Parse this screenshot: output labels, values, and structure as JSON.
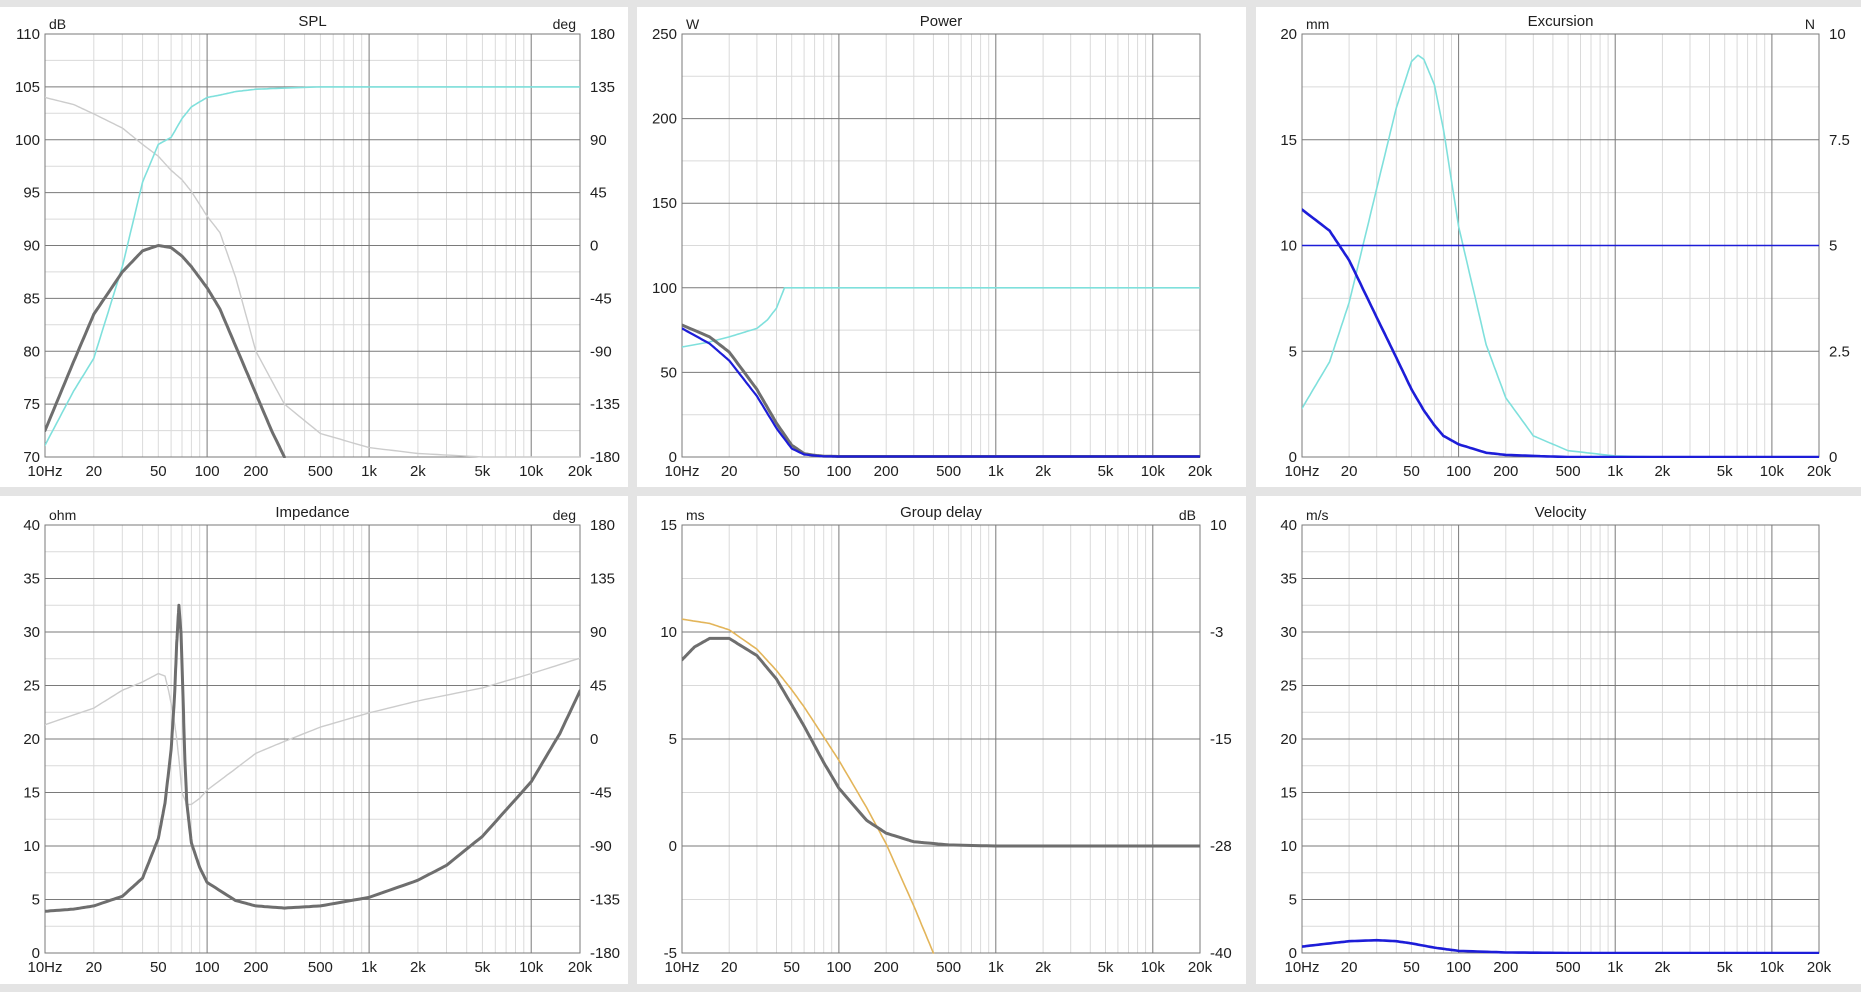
{
  "x_ticks": [
    "10Hz",
    "20",
    "50",
    "100",
    "200",
    "500",
    "1k",
    "2k",
    "5k",
    "10k",
    "20k"
  ],
  "chart_data": [
    {
      "type": "line",
      "title": "SPL",
      "y_unit": "dB",
      "y2_unit": "deg",
      "xscale": "log",
      "xlim": [
        10,
        20000
      ],
      "ylim": [
        70,
        110
      ],
      "y2lim": [
        -180,
        180
      ],
      "y_ticks": [
        "70",
        "75",
        "80",
        "85",
        "90",
        "95",
        "100",
        "105",
        "110"
      ],
      "y2_ticks": [
        "-180",
        "-135",
        "-90",
        "-45",
        "0",
        "45",
        "90",
        "135",
        "180"
      ],
      "series": [
        {
          "axis": "y2",
          "color": "#cccccc",
          "width": 1.4,
          "x": [
            10,
            15,
            20,
            30,
            40,
            50,
            60,
            70,
            80,
            100,
            120,
            150,
            200,
            300,
            500,
            1000,
            2000,
            5000,
            20000
          ],
          "y": [
            126,
            120,
            112,
            100,
            86,
            76,
            64,
            56,
            46,
            25,
            11,
            -27,
            -90,
            -135,
            -160,
            -172,
            -177,
            -180,
            -180
          ]
        },
        {
          "axis": "y2",
          "color": "#7fe0dc",
          "width": 1.6,
          "x": [
            10,
            15,
            20,
            30,
            40,
            50,
            60,
            70,
            80,
            100,
            120,
            150,
            200,
            300,
            500,
            1000,
            2000,
            5000,
            20000
          ],
          "y": [
            -170,
            -124,
            -96,
            -18,
            54,
            86,
            92,
            108,
            118,
            126,
            128,
            131,
            133,
            134,
            135,
            135,
            135,
            135,
            135
          ]
        },
        {
          "axis": "y",
          "color": "#6e6e6e",
          "width": 3,
          "x": [
            10,
            15,
            20,
            30,
            40,
            50,
            60,
            70,
            80,
            100,
            120,
            150,
            200,
            250,
            300
          ],
          "y": [
            72.5,
            79,
            83.5,
            87.5,
            89.5,
            90,
            89.8,
            89,
            88,
            86,
            84,
            80.5,
            76,
            72.5,
            70
          ]
        }
      ]
    },
    {
      "type": "line",
      "title": "Power",
      "y_unit": "W",
      "xscale": "log",
      "xlim": [
        10,
        20000
      ],
      "ylim": [
        0,
        250
      ],
      "y_ticks": [
        "0",
        "50",
        "100",
        "150",
        "200",
        "250"
      ],
      "series": [
        {
          "axis": "y",
          "color": "#7fe0dc",
          "width": 1.6,
          "x": [
            10,
            15,
            20,
            30,
            35,
            40,
            45,
            20000
          ],
          "y": [
            65,
            68,
            71,
            76,
            81,
            88,
            100,
            100
          ]
        },
        {
          "axis": "y",
          "color": "#6e6e6e",
          "width": 3,
          "x": [
            10,
            15,
            20,
            30,
            40,
            50,
            60,
            70,
            80,
            100,
            20000
          ],
          "y": [
            78,
            71,
            62,
            40,
            20,
            7,
            2,
            1,
            0.5,
            0.3,
            0.3
          ]
        },
        {
          "axis": "y",
          "color": "#1d1dd8",
          "width": 2.2,
          "x": [
            10,
            15,
            20,
            30,
            40,
            50,
            60,
            70,
            80,
            100,
            20000
          ],
          "y": [
            76,
            67,
            57,
            36,
            17,
            5,
            1.5,
            0.8,
            0.4,
            0.3,
            0.3
          ]
        }
      ]
    },
    {
      "type": "line",
      "title": "Excursion",
      "y_unit": "mm",
      "y2_unit": "N",
      "xscale": "log",
      "xlim": [
        10,
        20000
      ],
      "ylim": [
        0,
        20
      ],
      "y2lim": [
        0,
        10
      ],
      "y_ticks": [
        "0",
        "5",
        "10",
        "15",
        "20"
      ],
      "y2_ticks": [
        "0",
        "2.5",
        "5",
        "7.5",
        "10"
      ],
      "series": [
        {
          "axis": "y",
          "color": "#7fe0dc",
          "width": 1.6,
          "x": [
            10,
            15,
            20,
            30,
            40,
            50,
            55,
            60,
            70,
            80,
            100,
            150,
            200,
            300,
            500,
            1000,
            2000,
            5000,
            20000
          ],
          "y": [
            2.3,
            4.5,
            7.3,
            12.7,
            16.5,
            18.7,
            19,
            18.8,
            17.6,
            15.5,
            10.9,
            5.3,
            2.8,
            1,
            0.3,
            0.05,
            0,
            0,
            0
          ]
        },
        {
          "axis": "y2",
          "color": "#1d1dd8",
          "width": 1.4,
          "x": [
            10,
            20000
          ],
          "y": [
            5,
            5
          ]
        },
        {
          "axis": "y",
          "color": "#1d1dd8",
          "width": 2.6,
          "x": [
            10,
            15,
            20,
            30,
            40,
            50,
            60,
            70,
            80,
            100,
            150,
            200,
            300,
            500,
            1000,
            20000
          ],
          "y": [
            11.7,
            10.7,
            9.3,
            6.6,
            4.7,
            3.2,
            2.2,
            1.5,
            1,
            0.6,
            0.2,
            0.1,
            0.05,
            0,
            0,
            0
          ]
        }
      ]
    },
    {
      "type": "line",
      "title": "Impedance",
      "y_unit": "ohm",
      "y2_unit": "deg",
      "xscale": "log",
      "xlim": [
        10,
        20000
      ],
      "ylim": [
        0,
        40
      ],
      "y2lim": [
        -180,
        180
      ],
      "y_ticks": [
        "0",
        "5",
        "10",
        "15",
        "20",
        "25",
        "30",
        "35",
        "40"
      ],
      "y2_ticks": [
        "-180",
        "-135",
        "-90",
        "-45",
        "0",
        "45",
        "90",
        "135",
        "180"
      ],
      "series": [
        {
          "axis": "y2",
          "color": "#cccccc",
          "width": 1.4,
          "x": [
            10,
            20,
            30,
            40,
            50,
            55,
            58,
            62,
            65,
            68,
            70,
            75,
            80,
            90,
            100,
            150,
            200,
            300,
            500,
            1000,
            2000,
            5000,
            10000,
            20000
          ],
          "y": [
            12,
            26,
            41,
            48,
            55,
            53,
            40,
            20,
            0,
            -25,
            -45,
            -55,
            -55,
            -50,
            -43,
            -25,
            -12,
            -2,
            10,
            22,
            32,
            43,
            55,
            68
          ]
        },
        {
          "axis": "y",
          "color": "#6e6e6e",
          "width": 3,
          "x": [
            10,
            15,
            20,
            30,
            40,
            50,
            55,
            60,
            63,
            65,
            67,
            69,
            71,
            73,
            75,
            80,
            90,
            100,
            150,
            200,
            300,
            500,
            1000,
            2000,
            3000,
            5000,
            10000,
            15000,
            20000
          ],
          "y": [
            3.9,
            4.1,
            4.4,
            5.3,
            7,
            10.7,
            14,
            19,
            24,
            29,
            32.5,
            30,
            24,
            18,
            14,
            10.3,
            8,
            6.6,
            4.9,
            4.4,
            4.2,
            4.4,
            5.2,
            6.8,
            8.2,
            10.9,
            16,
            20.5,
            24.5
          ]
        }
      ]
    },
    {
      "type": "line",
      "title": "Group delay",
      "y_unit": "ms",
      "y2_unit": "dB",
      "xscale": "log",
      "xlim": [
        10,
        20000
      ],
      "ylim": [
        -5,
        15
      ],
      "y2lim": [
        -40,
        10
      ],
      "y_ticks": [
        "-5",
        "0",
        "5",
        "10",
        "15"
      ],
      "y2_ticks": [
        "-40",
        "-28",
        "-15",
        "-3",
        "10"
      ],
      "series": [
        {
          "axis": "y",
          "color": "#e3b55a",
          "width": 1.6,
          "x": [
            10,
            15,
            20,
            30,
            40,
            50,
            60,
            80,
            100,
            150,
            200,
            300,
            400
          ],
          "y": [
            10.6,
            10.4,
            10.1,
            9.2,
            8.2,
            7.3,
            6.5,
            5.1,
            4,
            1.8,
            0.1,
            -2.8,
            -5
          ]
        },
        {
          "axis": "y",
          "color": "#6e6e6e",
          "width": 3,
          "x": [
            10,
            12,
            15,
            20,
            30,
            40,
            50,
            60,
            80,
            100,
            150,
            200,
            300,
            500,
            1000,
            20000
          ],
          "y": [
            8.7,
            9.3,
            9.7,
            9.7,
            8.9,
            7.8,
            6.6,
            5.6,
            3.9,
            2.7,
            1.2,
            0.6,
            0.2,
            0.05,
            0,
            0
          ]
        }
      ]
    },
    {
      "type": "line",
      "title": "Velocity",
      "y_unit": "m/s",
      "xscale": "log",
      "xlim": [
        10,
        20000
      ],
      "ylim": [
        0,
        40
      ],
      "y_ticks": [
        "0",
        "5",
        "10",
        "15",
        "20",
        "25",
        "30",
        "35",
        "40"
      ],
      "series": [
        {
          "axis": "y",
          "color": "#1d1dd8",
          "width": 2.6,
          "x": [
            10,
            15,
            20,
            30,
            40,
            50,
            70,
            100,
            200,
            500,
            20000
          ],
          "y": [
            0.6,
            0.9,
            1.1,
            1.2,
            1.1,
            0.9,
            0.5,
            0.2,
            0.05,
            0,
            0
          ]
        }
      ]
    }
  ]
}
